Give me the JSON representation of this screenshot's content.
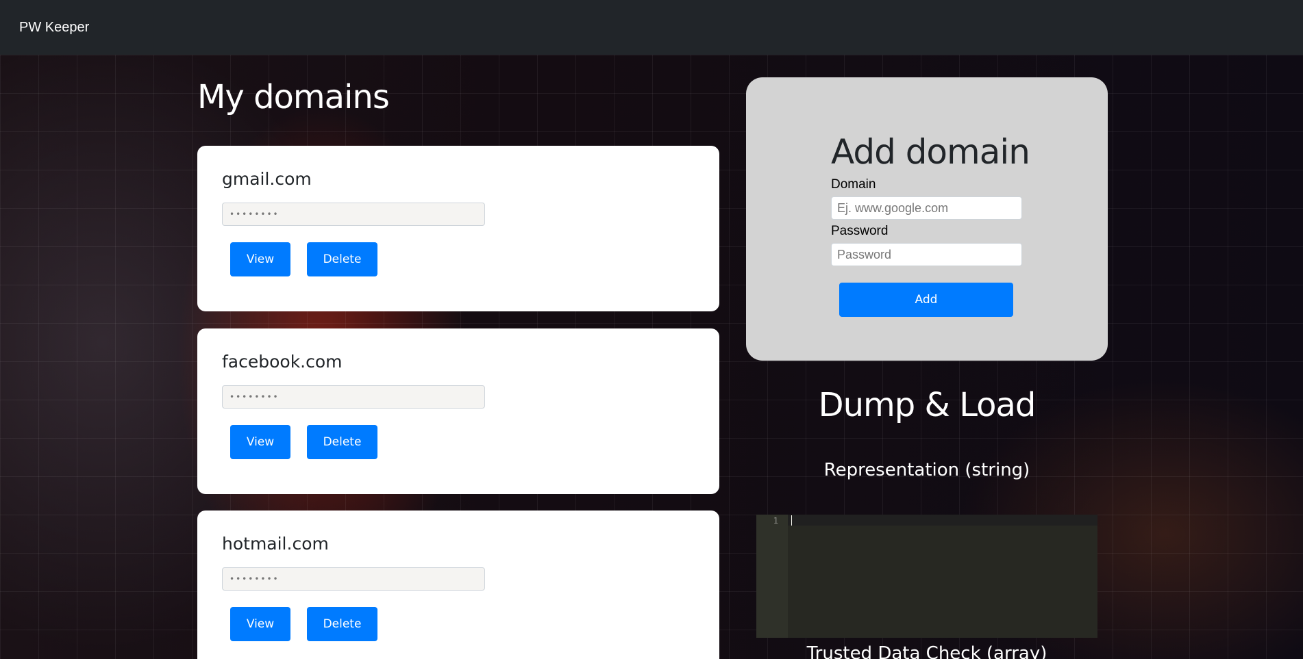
{
  "navbar": {
    "brand": "PW Keeper"
  },
  "domains_section": {
    "title": "My domains",
    "cards": [
      {
        "domain": "gmail.com",
        "masked_password": "••••••••",
        "view_label": "View",
        "delete_label": "Delete"
      },
      {
        "domain": "facebook.com",
        "masked_password": "••••••••",
        "view_label": "View",
        "delete_label": "Delete"
      },
      {
        "domain": "hotmail.com",
        "masked_password": "••••••••",
        "view_label": "View",
        "delete_label": "Delete"
      }
    ]
  },
  "add_domain": {
    "title": "Add domain",
    "domain_label": "Domain",
    "domain_placeholder": "Ej. www.google.com",
    "password_label": "Password",
    "password_placeholder": "Password",
    "add_label": "Add"
  },
  "dump_load": {
    "title": "Dump & Load",
    "representation_label": "Representation (string)",
    "editor_line_number": "1",
    "trusted_label": "Trusted Data Check (array)"
  },
  "colors": {
    "navbar": "#212529",
    "primary_button": "#007bff",
    "add_panel": "#d3d3d3",
    "editor_bg": "#272822"
  }
}
